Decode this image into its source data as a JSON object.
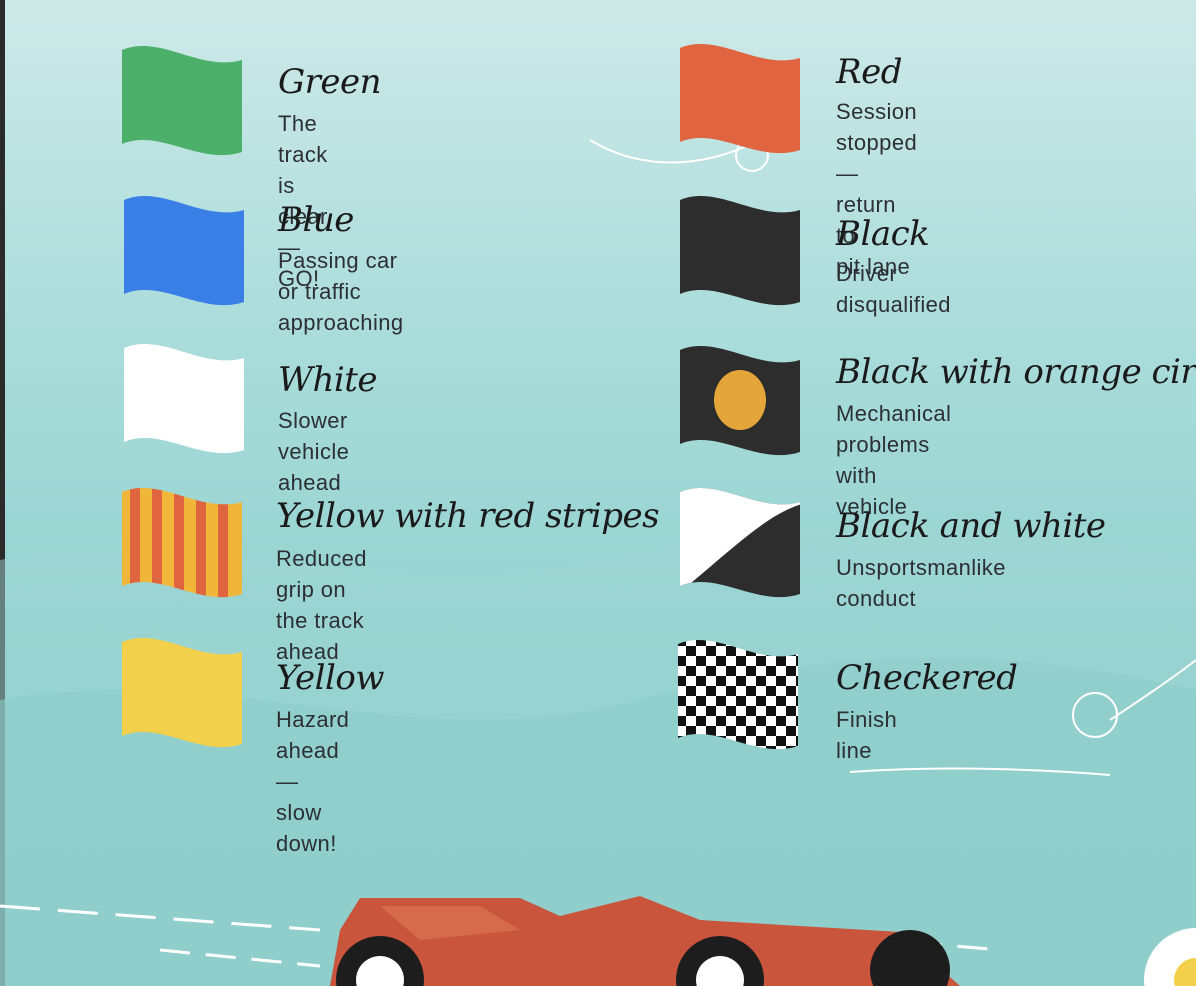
{
  "flags": [
    {
      "id": "green",
      "title": "Green",
      "desc_lines": [
        "The track is clear — GO!"
      ],
      "color": "#4caf6a"
    },
    {
      "id": "blue",
      "title": "Blue",
      "desc_lines": [
        "Passing car or traffic",
        "approaching"
      ],
      "color": "#3a7fe6"
    },
    {
      "id": "white",
      "title": "White",
      "desc_lines": [
        "Slower vehicle ahead"
      ],
      "color": "#ffffff"
    },
    {
      "id": "yellow-red-stripes",
      "title": "Yellow with red stripes",
      "desc_lines": [
        "Reduced grip on",
        "the track ahead"
      ],
      "color": "#f0b63a"
    },
    {
      "id": "yellow",
      "title": "Yellow",
      "desc_lines": [
        "Hazard ahead — slow down!"
      ],
      "color": "#f2d04b"
    },
    {
      "id": "red",
      "title": "Red",
      "desc_lines": [
        "Session stopped — return to",
        "pit lane"
      ],
      "color": "#e0643f"
    },
    {
      "id": "black",
      "title": "Black",
      "desc_lines": [
        "Driver disqualified"
      ],
      "color": "#2d2d2d"
    },
    {
      "id": "black-orange-circle",
      "title": "Black with orange circle",
      "desc_lines": [
        "Mechanical problems",
        "with vehicle"
      ],
      "color": "#2d2d2d"
    },
    {
      "id": "black-white",
      "title": "Black and white",
      "desc_lines": [
        "Unsportsmanlike conduct"
      ],
      "color": "#2d2d2d"
    },
    {
      "id": "checkered",
      "title": "Checkered",
      "desc_lines": [
        "Finish line"
      ],
      "color": "#111111"
    }
  ],
  "colors": {
    "accent_orange": "#e4a53a",
    "car_red": "#c9553d"
  }
}
